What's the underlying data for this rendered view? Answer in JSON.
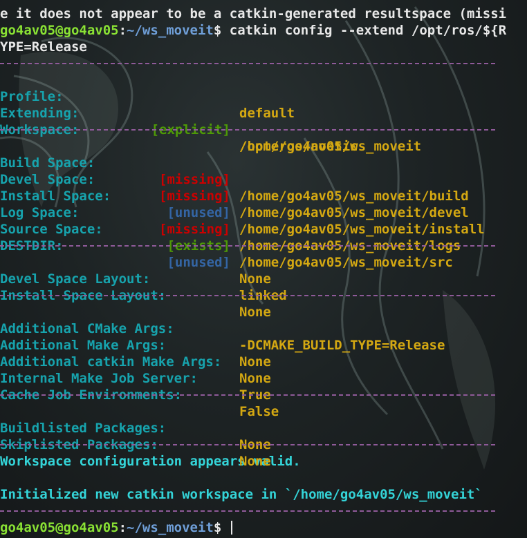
{
  "terminal": {
    "line1": "e it does not appear to be a catkin-generated resultspace (missi",
    "prompt_user_host": "go4av05@go4av05",
    "prompt_sep": ":",
    "prompt_path": "~/ws_moveit",
    "prompt_symbol": "$",
    "command": " catkin config --extend /opt/ros/${R",
    "command_wrap": "YPE=Release"
  },
  "profile_section": [
    {
      "label": "Profile:",
      "tag": "",
      "value": "default"
    },
    {
      "label": "Extending:",
      "tag": "[explicit]",
      "tag_color": "green",
      "value": "/opt/ros/noetic"
    },
    {
      "label": "Workspace:",
      "tag": "",
      "value": "/home/go4av05/ws_moveit"
    }
  ],
  "spaces_section": [
    {
      "label": "Build Space:",
      "tag": "[missing]",
      "tag_color": "red",
      "value": "/home/go4av05/ws_moveit/build"
    },
    {
      "label": "Devel Space:",
      "tag": "[missing]",
      "tag_color": "red",
      "value": "/home/go4av05/ws_moveit/devel"
    },
    {
      "label": "Install Space:",
      "tag": "[unused]",
      "tag_color": "blue",
      "value": "/home/go4av05/ws_moveit/install"
    },
    {
      "label": "Log Space:",
      "tag": "[missing]",
      "tag_color": "red",
      "value": "/home/go4av05/ws_moveit/logs"
    },
    {
      "label": "Source Space:",
      "tag": "[exists]",
      "tag_color": "green",
      "value": "/home/go4av05/ws_moveit/src"
    },
    {
      "label": "DESTDIR:",
      "tag": "[unused]",
      "tag_color": "blue",
      "value": "None"
    }
  ],
  "layout_section": [
    {
      "label": "Devel Space Layout:",
      "value": "linked"
    },
    {
      "label": "Install Space Layout:",
      "value": "None"
    }
  ],
  "args_section": [
    {
      "label": "Additional CMake Args:",
      "value": "-DCMAKE_BUILD_TYPE=Release"
    },
    {
      "label": "Additional Make Args:",
      "value": "None"
    },
    {
      "label": "Additional catkin Make Args:",
      "value": "None"
    },
    {
      "label": "Internal Make Job Server:",
      "value": "True"
    },
    {
      "label": "Cache Job Environments:",
      "value": "False"
    }
  ],
  "packages_section": [
    {
      "label": "Buildlisted Packages:",
      "value": "None"
    },
    {
      "label": "Skiplisted Packages:",
      "value": "None"
    }
  ],
  "messages": {
    "valid": "Workspace configuration appears valid.",
    "initialized": "Initialized new catkin workspace in `/home/go4av05/ws_moveit`"
  },
  "colors": {
    "background": "#1d2324",
    "label": "#17a3ad",
    "value": "#d4a812",
    "separator": "#8f5a99",
    "prompt_user": "#8ae234",
    "prompt_path": "#6f9fd8",
    "tag_green": "#4e9a06",
    "tag_red": "#cc0000",
    "tag_blue": "#3465a4"
  }
}
